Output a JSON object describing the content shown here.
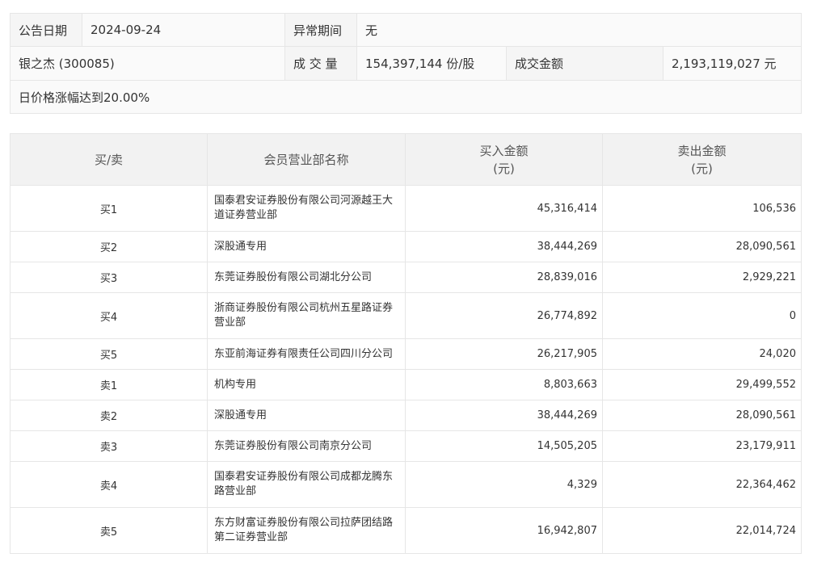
{
  "info": {
    "date_label": "公告日期",
    "date_value": "2024-09-24",
    "period_label": "异常期间",
    "period_value": "无",
    "stock": "银之杰 (300085)",
    "volume_label": "成 交 量",
    "volume_value": "154,397,144 份/股",
    "amount_label": "成交金额",
    "amount_value": "2,193,119,027 元",
    "reason": "日价格涨幅达到20.00%"
  },
  "table": {
    "headers": {
      "side": "买/卖",
      "name": "会员营业部名称",
      "buy_line1": "买入金额",
      "buy_line2": "(元)",
      "sell_line1": "卖出金额",
      "sell_line2": "(元)"
    },
    "rows": [
      {
        "side": "买1",
        "name": "国泰君安证券股份有限公司河源越王大道证券营业部",
        "buy": "45,316,414",
        "sell": "106,536"
      },
      {
        "side": "买2",
        "name": "深股通专用",
        "buy": "38,444,269",
        "sell": "28,090,561"
      },
      {
        "side": "买3",
        "name": "东莞证券股份有限公司湖北分公司",
        "buy": "28,839,016",
        "sell": "2,929,221"
      },
      {
        "side": "买4",
        "name": "浙商证券股份有限公司杭州五星路证券营业部",
        "buy": "26,774,892",
        "sell": "0"
      },
      {
        "side": "买5",
        "name": "东亚前海证券有限责任公司四川分公司",
        "buy": "26,217,905",
        "sell": "24,020"
      },
      {
        "side": "卖1",
        "name": "机构专用",
        "buy": "8,803,663",
        "sell": "29,499,552"
      },
      {
        "side": "卖2",
        "name": "深股通专用",
        "buy": "38,444,269",
        "sell": "28,090,561"
      },
      {
        "side": "卖3",
        "name": "东莞证券股份有限公司南京分公司",
        "buy": "14,505,205",
        "sell": "23,179,911"
      },
      {
        "side": "卖4",
        "name": "国泰君安证券股份有限公司成都龙腾东路营业部",
        "buy": "4,329",
        "sell": "22,364,462"
      },
      {
        "side": "卖5",
        "name": "东方财富证券股份有限公司拉萨团结路第二证券营业部",
        "buy": "16,942,807",
        "sell": "22,014,724"
      }
    ]
  }
}
